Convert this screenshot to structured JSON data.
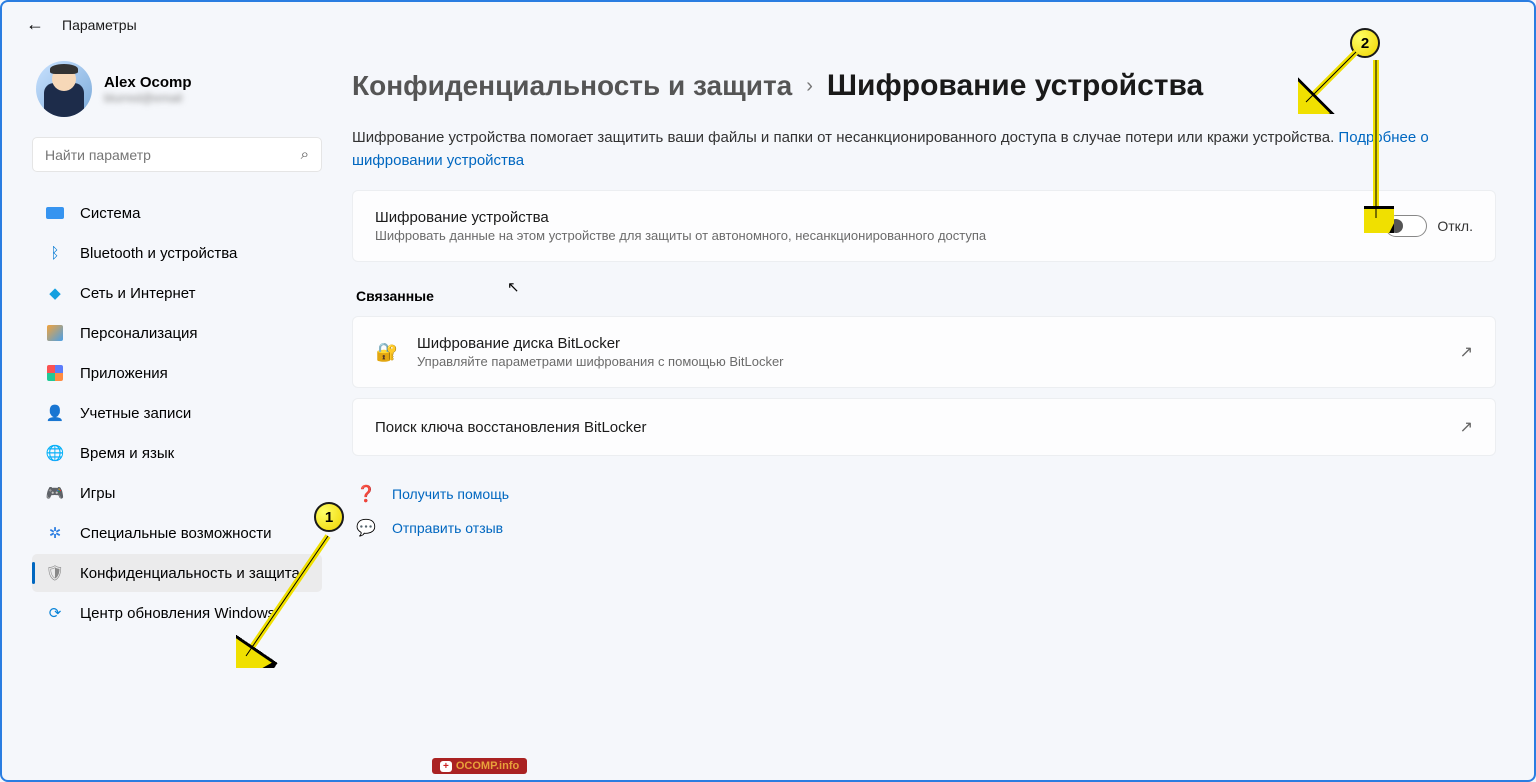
{
  "header": {
    "title": "Параметры"
  },
  "user": {
    "name": "Alex Ocomp",
    "email": "blurred@email"
  },
  "search": {
    "placeholder": "Найти параметр"
  },
  "sidebar": {
    "items": [
      {
        "label": "Система"
      },
      {
        "label": "Bluetooth и устройства"
      },
      {
        "label": "Сеть и Интернет"
      },
      {
        "label": "Персонализация"
      },
      {
        "label": "Приложения"
      },
      {
        "label": "Учетные записи"
      },
      {
        "label": "Время и язык"
      },
      {
        "label": "Игры"
      },
      {
        "label": "Специальные возможности"
      },
      {
        "label": "Конфиденциальность и защита"
      },
      {
        "label": "Центр обновления Windows"
      }
    ]
  },
  "breadcrumb": {
    "parent": "Конфиденциальность и защита",
    "sep": "›",
    "current": "Шифрование устройства"
  },
  "description": {
    "text": "Шифрование устройства помогает защитить ваши файлы и папки от несанкционированного доступа в случае потери или кражи устройства. ",
    "link": "Подробнее о шифровании устройства"
  },
  "encryption_card": {
    "title": "Шифрование устройства",
    "sub": "Шифровать данные на этом устройстве для защиты от автономного, несанкционированного доступа",
    "toggle_label": "Откл."
  },
  "related": {
    "heading": "Связанные",
    "bitlocker": {
      "title": "Шифрование диска BitLocker",
      "sub": "Управляйте параметрами шифрования с помощью BitLocker"
    },
    "recovery": {
      "title": "Поиск ключа восстановления BitLocker"
    }
  },
  "help": {
    "get_help": "Получить помощь",
    "feedback": "Отправить отзыв"
  },
  "annotations": {
    "one": "1",
    "two": "2"
  },
  "watermark": "OCOMP.info"
}
